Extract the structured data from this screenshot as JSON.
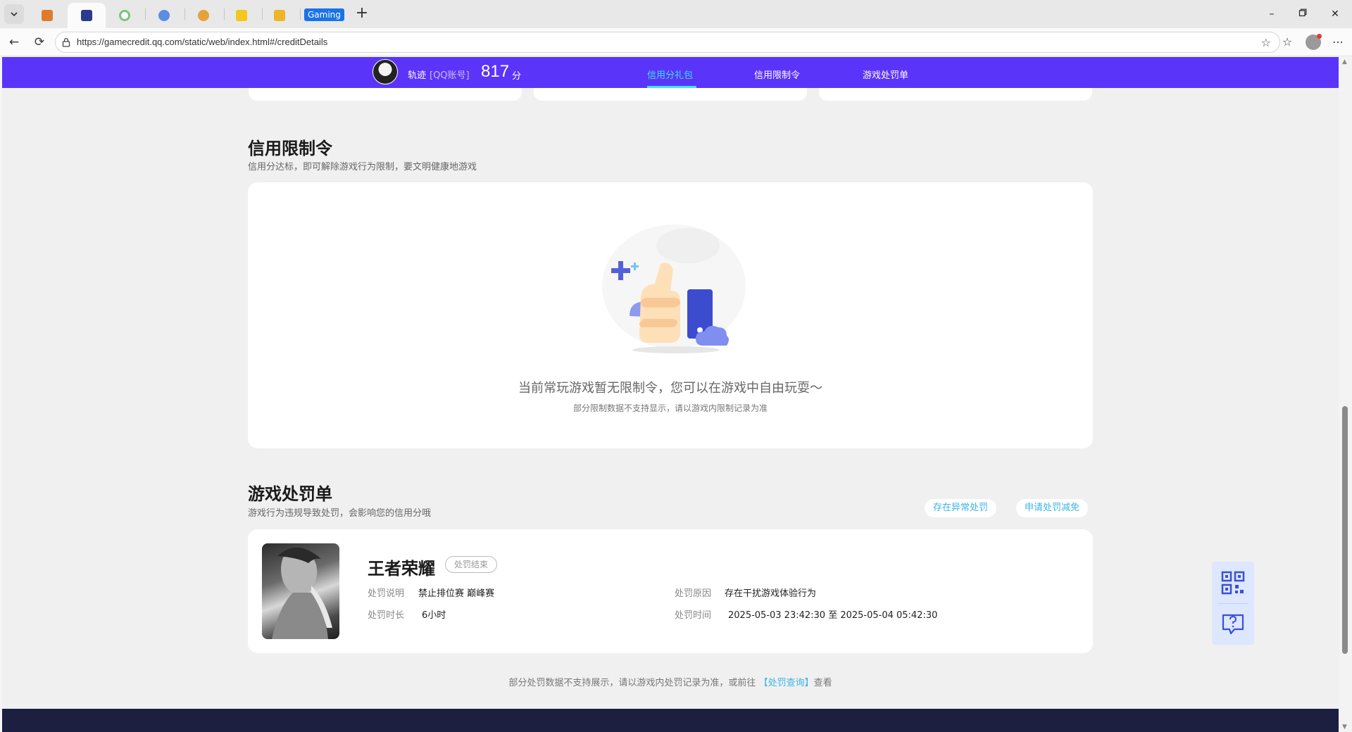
{
  "browser": {
    "tab_gaming_label": "Gaming",
    "url": "https://gamecredit.qq.com/static/web/index.html#/creditDetails"
  },
  "header": {
    "user_name": "轨迹",
    "account_type": "[QQ账号]",
    "score": "817",
    "score_unit": "分",
    "tabs": [
      {
        "label": "信用分礼包",
        "active": true
      },
      {
        "label": "信用限制令",
        "active": false
      },
      {
        "label": "游戏处罚单",
        "active": false
      }
    ]
  },
  "restriction": {
    "title": "信用限制令",
    "subtitle": "信用分达标，即可解除游戏行为限制，要文明健康地游戏",
    "empty_text": "当前常玩游戏暂无限制令，您可以在游戏中自由玩耍～",
    "empty_note": "部分限制数据不支持显示，请以游戏内限制记录为准"
  },
  "penalty": {
    "title": "游戏处罚单",
    "subtitle": "游戏行为违规导致处罚，会影响您的信用分哦",
    "btn_abnormal": "存在异常处罚",
    "btn_reduce": "申请处罚减免",
    "game_name": "王者荣耀",
    "status": "处罚结束",
    "desc_label": "处罚说明",
    "desc_value": "禁止排位赛 巅峰赛",
    "duration_label": "处罚时长",
    "duration_value": "6小时",
    "reason_label": "处罚原因",
    "reason_value": "存在干扰游戏体验行为",
    "time_label": "处罚时间",
    "time_value": "2025-05-03 23:42:30 至 2025-05-04 05:42:30"
  },
  "footer": {
    "note_before": "部分处罚数据不支持展示，请以游戏内处罚记录为准，或前往",
    "note_link": "【处罚查询】",
    "note_after": "查看"
  },
  "colors": {
    "nav_bg": "#5a34f9",
    "accent_cyan": "#3ee0ff",
    "link_blue": "#3bb4e8",
    "footer_bg": "#1c1f3f"
  }
}
